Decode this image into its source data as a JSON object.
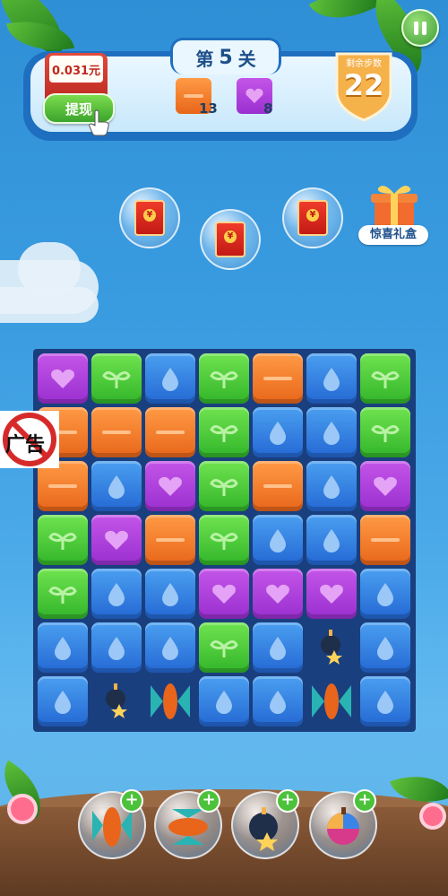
{
  "hud": {
    "level_prefix": "第",
    "level_number": "5",
    "level_suffix": "关",
    "money": "0.031元",
    "withdraw_label": "提现",
    "moves_label": "剩余步数",
    "moves_value": "22",
    "goals": [
      {
        "icon": "orange-tile-icon",
        "count": "13"
      },
      {
        "icon": "purple-heart-tile-icon",
        "count": "8"
      }
    ]
  },
  "rewards": {
    "gift_label": "惊喜礼盒"
  },
  "ad_badge": "广告",
  "board": {
    "rows": 7,
    "cols": 7,
    "tiles": [
      [
        "purple",
        "green",
        "blue",
        "green",
        "orange",
        "blue",
        "green"
      ],
      [
        "orange",
        "orange",
        "orange",
        "green",
        "blue",
        "blue",
        "green"
      ],
      [
        "orange",
        "blue",
        "purple",
        "green",
        "orange",
        "blue",
        "purple"
      ],
      [
        "green",
        "purple",
        "orange",
        "green",
        "blue",
        "blue",
        "orange"
      ],
      [
        "green",
        "blue",
        "blue",
        "purple",
        "purple",
        "purple",
        "blue"
      ],
      [
        "blue",
        "blue",
        "blue",
        "green",
        "blue",
        "bomb",
        "blue"
      ],
      [
        "blue",
        "bomb",
        "rocket",
        "blue",
        "blue",
        "rocket",
        "blue"
      ]
    ]
  },
  "boosters": [
    {
      "icon": "rocket-booster-icon"
    },
    {
      "icon": "horizontal-rocket-booster-icon"
    },
    {
      "icon": "bomb-booster-icon"
    },
    {
      "icon": "color-ball-booster-icon"
    }
  ],
  "colors": {
    "purple": "#b040dc",
    "green": "#4ccb3a",
    "blue": "#3584e4",
    "orange": "#f27f2e",
    "board_bg": "#1a3f7e"
  }
}
